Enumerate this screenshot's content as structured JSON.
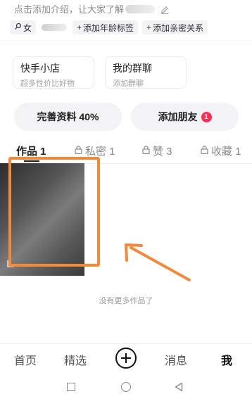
{
  "intro": {
    "text": "点击添加介绍，让大家了解",
    "icon": "edit-icon"
  },
  "tags": [
    {
      "label": "女",
      "icon": "female-icon"
    },
    {
      "label": "添加年龄标签",
      "icon": "plus-icon"
    },
    {
      "label": "添加亲密关系",
      "icon": "plus-icon"
    }
  ],
  "cards": [
    {
      "title": "快手小店",
      "subtitle": "超多性价比好物"
    },
    {
      "title": "我的群聊",
      "subtitle": "添加群聊"
    }
  ],
  "actions": {
    "complete_profile": "完善资料 40%",
    "add_friends": "添加朋友",
    "add_friends_badge": "1"
  },
  "tabs": [
    {
      "label": "作品 1",
      "locked": false
    },
    {
      "label": "私密 1",
      "locked": true
    },
    {
      "label": "赞 3",
      "locked": true
    },
    {
      "label": "收藏 1",
      "locked": true
    }
  ],
  "empty_text": "没有更多作品了",
  "bottom_nav": {
    "home": "首页",
    "featured": "精选",
    "messages": "消息",
    "me": "我"
  },
  "colors": {
    "highlight": "#f28a3a",
    "badge": "#fe2c55"
  }
}
